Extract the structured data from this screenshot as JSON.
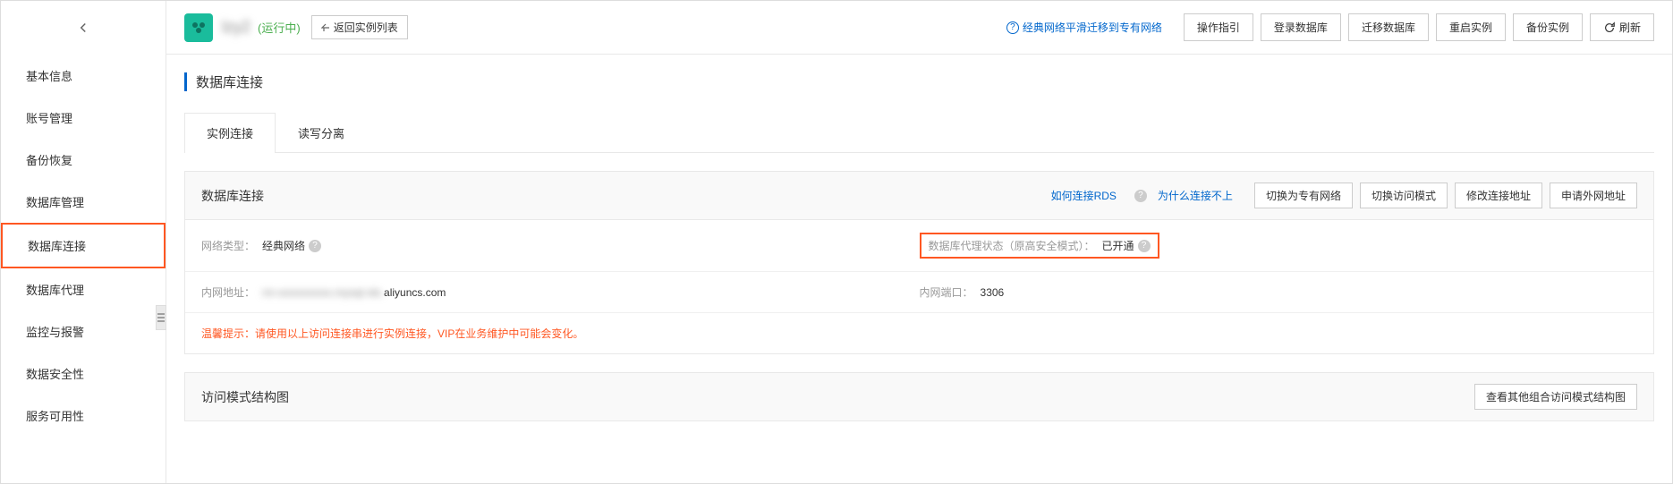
{
  "sidebar": {
    "items": [
      {
        "label": "基本信息"
      },
      {
        "label": "账号管理"
      },
      {
        "label": "备份恢复"
      },
      {
        "label": "数据库管理"
      },
      {
        "label": "数据库连接"
      },
      {
        "label": "数据库代理"
      },
      {
        "label": "监控与报警"
      },
      {
        "label": "数据安全性"
      },
      {
        "label": "服务可用性"
      }
    ]
  },
  "header": {
    "instance_name": "lzy2",
    "status": "(运行中)",
    "back_list": "返回实例列表",
    "migration_link": "经典网络平滑迁移到专有网络",
    "buttons": {
      "guide": "操作指引",
      "login_db": "登录数据库",
      "migrate_db": "迁移数据库",
      "restart": "重启实例",
      "backup": "备份实例",
      "refresh": "刷新"
    }
  },
  "section": {
    "title": "数据库连接"
  },
  "tabs": {
    "instance_conn": "实例连接",
    "rw_split": "读写分离"
  },
  "panel": {
    "title": "数据库连接",
    "link_how": "如何连接RDS",
    "link_why": "为什么连接不上",
    "btn_switch_vpc": "切换为专有网络",
    "btn_switch_mode": "切换访问模式",
    "btn_modify_addr": "修改连接地址",
    "btn_apply_public": "申请外网地址",
    "row1": {
      "network_type_label": "网络类型：",
      "network_type_value": "经典网络",
      "proxy_status_label": "数据库代理状态（原高安全模式）：",
      "proxy_status_value": "已开通"
    },
    "row2": {
      "internal_addr_label": "内网地址：",
      "internal_addr_masked": "rm-xxxxxxxxxx.mysql.rds.",
      "internal_addr_suffix": "aliyuncs.com",
      "internal_port_label": "内网端口：",
      "internal_port_value": "3306"
    },
    "warning": "温馨提示：请使用以上访问连接串进行实例连接，VIP在业务维护中可能会变化。"
  },
  "panel2": {
    "title": "访问模式结构图",
    "btn_view_other": "查看其他组合访问模式结构图"
  }
}
